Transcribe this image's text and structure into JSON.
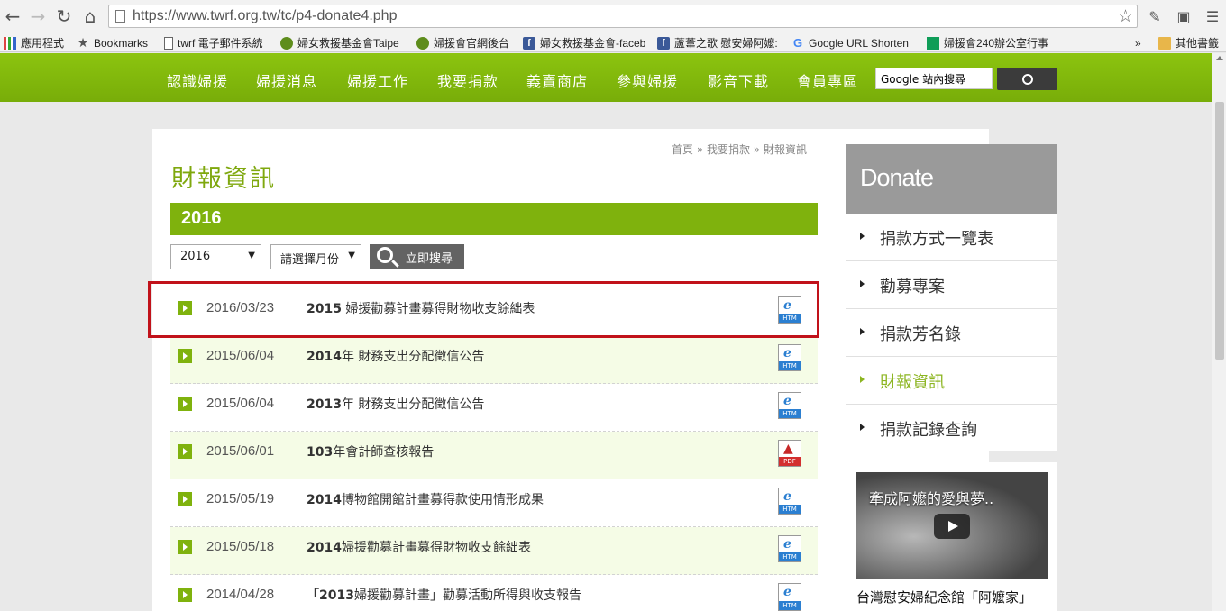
{
  "browser": {
    "url": "https://www.twrf.org.tw/tc/p4-donate4.php",
    "bookmarks": [
      {
        "label": "應用程式",
        "icon": "apps-icon"
      },
      {
        "label": "Bookmarks",
        "icon": "star-icon"
      },
      {
        "label": "twrf 電子郵件系統",
        "icon": "page-icon"
      },
      {
        "label": "婦女救援基金會Taipe",
        "icon": "twrf-icon"
      },
      {
        "label": "婦援會官網後台",
        "icon": "twrf-icon"
      },
      {
        "label": "婦女救援基金會-faceb",
        "icon": "facebook-icon"
      },
      {
        "label": "蘆葦之歌 慰安婦阿嬤:",
        "icon": "facebook-icon"
      },
      {
        "label": "Google URL Shorten",
        "icon": "google-icon"
      },
      {
        "label": "婦援會240辦公室行事",
        "icon": "sheets-icon"
      },
      {
        "label": "其他書籤",
        "icon": "folder-icon"
      }
    ],
    "overflow_label": "»"
  },
  "site_nav": {
    "items": [
      "認識婦援",
      "婦援消息",
      "婦援工作",
      "我要捐款",
      "義賣商店",
      "參與婦援",
      "影音下載",
      "會員專區"
    ],
    "search_placeholder": "Google 站內搜尋"
  },
  "breadcrumb": "首頁 » 我要捐款 » 財報資訊",
  "page_title": "財報資訊",
  "year_heading": "2016",
  "filters": {
    "year_value": "2016",
    "month_value": "請選擇月份",
    "search_label": "立即搜尋"
  },
  "documents": [
    {
      "date": "2016/03/23",
      "title_bold": "2015",
      "title_rest": " 婦援勸募計畫募得財物收支餘絀表",
      "file_type": "HTM"
    },
    {
      "date": "2015/06/04",
      "title_bold": "2014",
      "title_rest": "年 財務支出分配徵信公告",
      "file_type": "HTM"
    },
    {
      "date": "2015/06/04",
      "title_bold": "2013",
      "title_rest": "年 財務支出分配徵信公告",
      "file_type": "HTM"
    },
    {
      "date": "2015/06/01",
      "title_bold": "103",
      "title_rest": "年會計師查核報告",
      "file_type": "PDF"
    },
    {
      "date": "2015/05/19",
      "title_bold": "2014",
      "title_rest": "博物館開館計畫募得款使用情形成果",
      "file_type": "HTM"
    },
    {
      "date": "2015/05/18",
      "title_bold": "2014",
      "title_rest": "婦援勸募計畫募得財物收支餘絀表",
      "file_type": "HTM"
    },
    {
      "date": "2014/04/28",
      "title_bold": "「2013",
      "title_rest": "婦援勸募計畫」勸募活動所得與收支報告",
      "file_type": "HTM"
    }
  ],
  "sidebar": {
    "heading": "Donate",
    "items": [
      {
        "label": "捐款方式一覽表",
        "active": false
      },
      {
        "label": "勸募專案",
        "active": false
      },
      {
        "label": "捐款芳名錄",
        "active": false
      },
      {
        "label": "財報資訊",
        "active": true
      },
      {
        "label": "捐款記錄查詢",
        "active": false
      }
    ],
    "video_title": "牽成阿嬤的愛與夢..",
    "video_caption": "台灣慰安婦紀念館「阿嬤家」"
  },
  "colors": {
    "brand_green": "#7fb20d",
    "highlight_red": "#c1121a",
    "active_side": "#8cb521"
  }
}
